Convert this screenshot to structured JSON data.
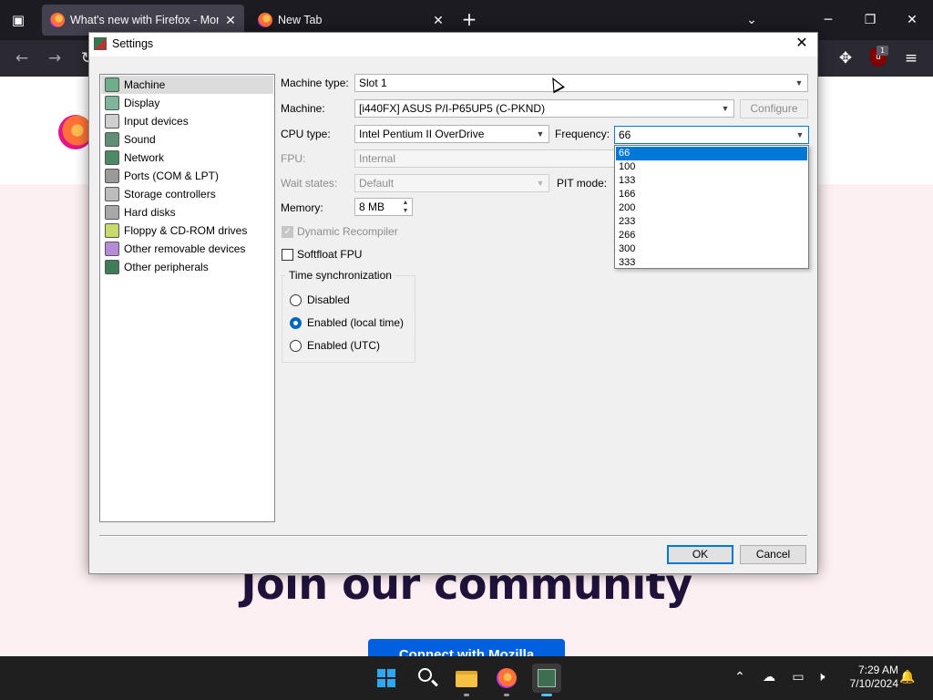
{
  "browser": {
    "tabs": [
      {
        "title": "What's new with Firefox - More",
        "active": true
      },
      {
        "title": "New Tab",
        "active": false
      }
    ],
    "ublock_badge": "1"
  },
  "page": {
    "headline": "Join our community",
    "cta": "Connect with Mozilla"
  },
  "dialog": {
    "title": "Settings",
    "categories": [
      {
        "label": "Machine",
        "icon": "machine-icon",
        "selected": true
      },
      {
        "label": "Display",
        "icon": "display-icon"
      },
      {
        "label": "Input devices",
        "icon": "input-devices-icon"
      },
      {
        "label": "Sound",
        "icon": "sound-icon"
      },
      {
        "label": "Network",
        "icon": "network-icon"
      },
      {
        "label": "Ports (COM & LPT)",
        "icon": "ports-icon"
      },
      {
        "label": "Storage controllers",
        "icon": "storage-controllers-icon"
      },
      {
        "label": "Hard disks",
        "icon": "hard-disks-icon"
      },
      {
        "label": "Floppy & CD-ROM drives",
        "icon": "floppy-cdrom-icon"
      },
      {
        "label": "Other removable devices",
        "icon": "removable-devices-icon"
      },
      {
        "label": "Other peripherals",
        "icon": "peripherals-icon"
      }
    ],
    "machine": {
      "machine_type_label": "Machine type:",
      "machine_type_value": "Slot 1",
      "machine_label": "Machine:",
      "machine_value": "[i440FX] ASUS P/I-P65UP5 (C-PKND)",
      "configure_label": "Configure",
      "cpu_type_label": "CPU type:",
      "cpu_type_value": "Intel Pentium II OverDrive",
      "frequency_label": "Frequency:",
      "frequency_value": "66",
      "frequency_options": [
        "66",
        "100",
        "133",
        "166",
        "200",
        "233",
        "266",
        "300",
        "333"
      ],
      "fpu_label": "FPU:",
      "fpu_value": "Internal",
      "wait_states_label": "Wait states:",
      "wait_states_value": "Default",
      "pit_mode_label": "PIT mode:",
      "memory_label": "Memory:",
      "memory_value": "8 MB",
      "dynamic_recompiler_label": "Dynamic Recompiler",
      "dynamic_recompiler_checked": true,
      "softfloat_label": "Softfloat FPU",
      "softfloat_checked": false,
      "time_sync_title": "Time synchronization",
      "time_sync_options": [
        {
          "label": "Disabled",
          "selected": false
        },
        {
          "label": "Enabled (local time)",
          "selected": true
        },
        {
          "label": "Enabled (UTC)",
          "selected": false
        }
      ]
    },
    "ok_label": "OK",
    "cancel_label": "Cancel"
  },
  "taskbar": {
    "time": "7:29 AM",
    "date": "7/10/2024"
  },
  "colors": {
    "accent": "#0078d7",
    "firefox_tab_bg": "#1c1b22",
    "page_pink": "#fdf0f2",
    "cta_blue": "#0060df",
    "headline": "#20123a"
  }
}
